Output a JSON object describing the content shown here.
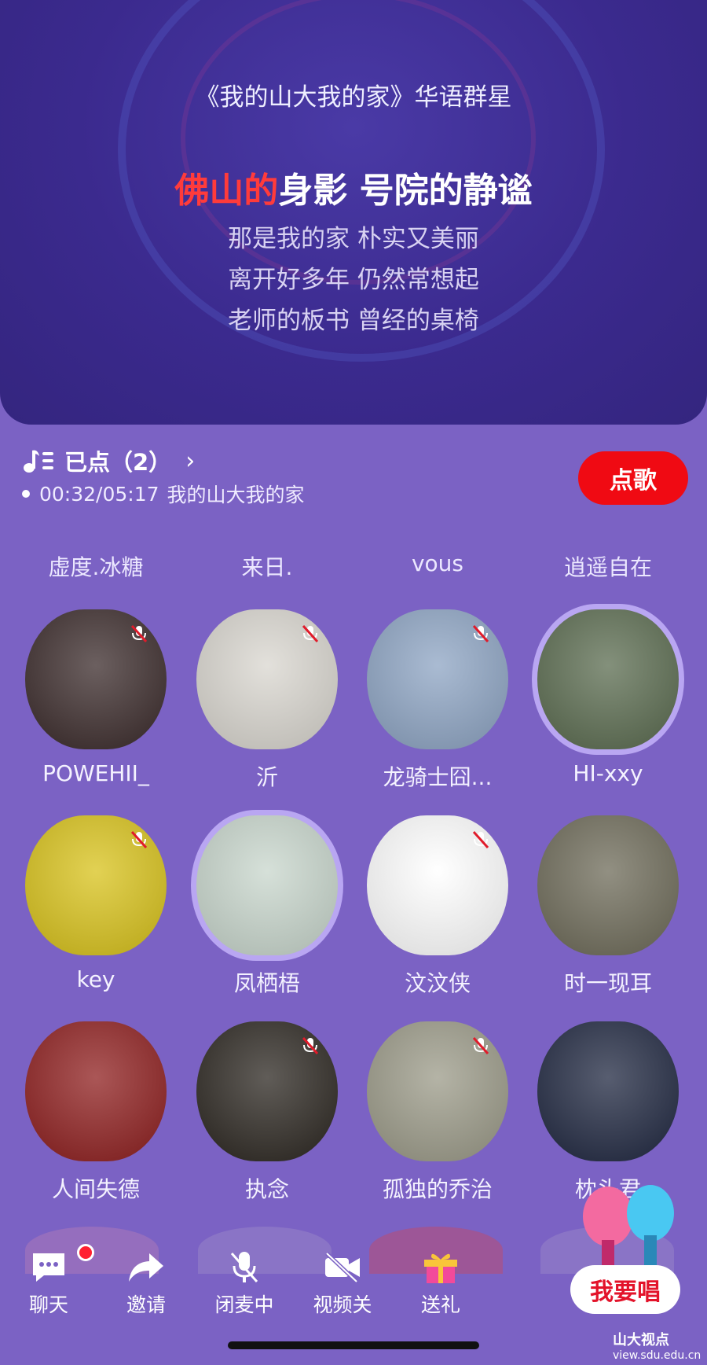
{
  "banner": {
    "song_title": "《我的山大我的家》华语群星",
    "lyric_sung": "佛山的",
    "lyric_rest": "身影 号院的静谧",
    "lyric_lines": [
      "那是我的家 朴实又美丽",
      "离开好多年 仍然常想起",
      "老师的板书 曾经的桌椅"
    ]
  },
  "queue": {
    "label": "已点（2）",
    "chevron": "›",
    "progress_time": "00:32/05:17",
    "progress_song": "我的山大我的家",
    "order_button": "点歌"
  },
  "top_row_names": [
    "虚度.冰糖",
    "来日.",
    "vous",
    "逍遥自在"
  ],
  "seats": [
    {
      "name": "POWEHII_",
      "bg": "#3a2a2a",
      "muted": true,
      "ring": false
    },
    {
      "name": "沂",
      "bg": "#d9d6cf",
      "muted": true,
      "ring": false
    },
    {
      "name": "龙骑士囧...",
      "bg": "#8da4c3",
      "muted": true,
      "ring": false
    },
    {
      "name": "HI-xxy",
      "bg": "#5a6b4f",
      "muted": false,
      "ring": true
    },
    {
      "name": "key",
      "bg": "#d8c21a",
      "muted": true,
      "ring": false
    },
    {
      "name": "凤栖梧",
      "bg": "#c8d6cc",
      "muted": false,
      "ring": true
    },
    {
      "name": "汶汶侠",
      "bg": "#ffffff",
      "muted": true,
      "ring": false
    },
    {
      "name": "时一现耳",
      "bg": "#6d6a58",
      "muted": false,
      "ring": false
    },
    {
      "name": "人间失德",
      "bg": "#8e1e1e",
      "muted": false,
      "ring": false
    },
    {
      "name": "执念",
      "bg": "#2b2620",
      "muted": true,
      "ring": false
    },
    {
      "name": "孤独的乔治",
      "bg": "#9b9a88",
      "muted": true,
      "ring": false
    },
    {
      "name": "枕头君",
      "bg": "#1f2740",
      "muted": false,
      "ring": false
    }
  ],
  "toolbar": {
    "chat": "聊天",
    "invite": "邀请",
    "mic_off": "闭麦中",
    "video_off": "视频关",
    "gift": "送礼"
  },
  "sing_button": "我要唱",
  "brand": {
    "name": "山大视点",
    "url": "view.sdu.edu.cn"
  },
  "colors": {
    "accent_red": "#f00a13",
    "background": "#7b62c4",
    "banner": "#3b2a8e"
  }
}
